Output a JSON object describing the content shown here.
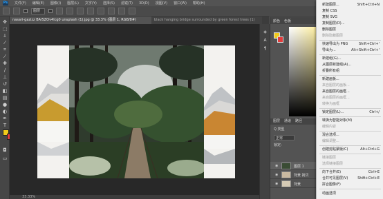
{
  "menubar": {
    "logo": "Ps",
    "items": [
      "文件(F)",
      "编辑(E)",
      "图像(I)",
      "图层(L)",
      "文字(Y)",
      "选择(S)",
      "滤镜(T)",
      "3D(D)",
      "视图(V)",
      "窗口(W)",
      "帮助(H)"
    ]
  },
  "options_bar": {
    "select_value": "图层"
  },
  "tabs": [
    {
      "label": "nasari-gazizz BAISZOv4lcg0 unsplash (1).jpg @ 33.3% (图层 1, RGB/8#)",
      "active": true
    },
    {
      "label": "black hanging bridge surrounded by green forest trees (1)",
      "active": false
    }
  ],
  "status": {
    "zoom": "33.33%"
  },
  "color_panel": {
    "tabs": [
      "颜色",
      "色板"
    ],
    "fg": "#f2cb1b",
    "bg": "#e23b3b"
  },
  "layers_panel": {
    "tabs": [
      "图层",
      "通道",
      "路径"
    ],
    "filter_label": "Q 类型",
    "blend": "正常",
    "lock_label": "锁定:",
    "layers": [
      {
        "name": "图层 1"
      },
      {
        "name": "背景 拷贝"
      },
      {
        "name": "背景"
      }
    ]
  },
  "context_menu": {
    "items": [
      {
        "label": "新建图层...",
        "shortcut": "Shift+Ctrl+N",
        "enabled": true
      },
      {
        "label": "复制 CSS",
        "shortcut": "",
        "enabled": true
      },
      {
        "label": "复制 SVG",
        "shortcut": "",
        "enabled": true
      },
      {
        "label": "复制图层(D)...",
        "shortcut": "",
        "enabled": true
      },
      {
        "label": "删除图层",
        "shortcut": "",
        "enabled": true
      },
      {
        "label": "删除隐藏图层",
        "shortcut": "",
        "enabled": false
      },
      {
        "label": "快速导出为 PNG",
        "shortcut": "Shift+Ctrl+'",
        "enabled": true
      },
      {
        "label": "导出为...",
        "shortcut": "Alt+Shift+Ctrl+'",
        "enabled": true
      },
      {
        "label": "新建组(G)...",
        "shortcut": "",
        "enabled": true
      },
      {
        "label": "从图层新建组(A)...",
        "shortcut": "",
        "enabled": true
      },
      {
        "label": "折叠所有组",
        "shortcut": "",
        "enabled": true
      },
      {
        "label": "新建画板...",
        "shortcut": "",
        "enabled": true
      },
      {
        "label": "来自图层的画板...",
        "shortcut": "",
        "enabled": false
      },
      {
        "label": "来自图层的画框...",
        "shortcut": "",
        "enabled": true
      },
      {
        "label": "来自图层的画框...",
        "shortcut": "",
        "enabled": false
      },
      {
        "label": "转换为画框",
        "shortcut": "",
        "enabled": false
      },
      {
        "label": "锁定图层(L)...",
        "shortcut": "Ctrl+/",
        "enabled": true
      },
      {
        "label": "转换为智能对象(M)",
        "shortcut": "",
        "enabled": true
      },
      {
        "label": "编辑内容",
        "shortcut": "",
        "enabled": false
      },
      {
        "label": "混合选项...",
        "shortcut": "",
        "enabled": true
      },
      {
        "label": "编辑调整...",
        "shortcut": "",
        "enabled": false
      },
      {
        "label": "创建剪贴蒙版(C)",
        "shortcut": "Alt+Ctrl+G",
        "enabled": true
      },
      {
        "label": "链接图层",
        "shortcut": "",
        "enabled": false
      },
      {
        "label": "选择链接图层",
        "shortcut": "",
        "enabled": false
      },
      {
        "label": "向下合并(E)",
        "shortcut": "Ctrl+E",
        "enabled": true
      },
      {
        "label": "合并可见图层(V)",
        "shortcut": "Shift+Ctrl+E",
        "enabled": true
      },
      {
        "label": "拼合图像(F)",
        "shortcut": "",
        "enabled": true
      },
      {
        "label": "动画选项",
        "shortcut": "",
        "enabled": true
      }
    ]
  }
}
